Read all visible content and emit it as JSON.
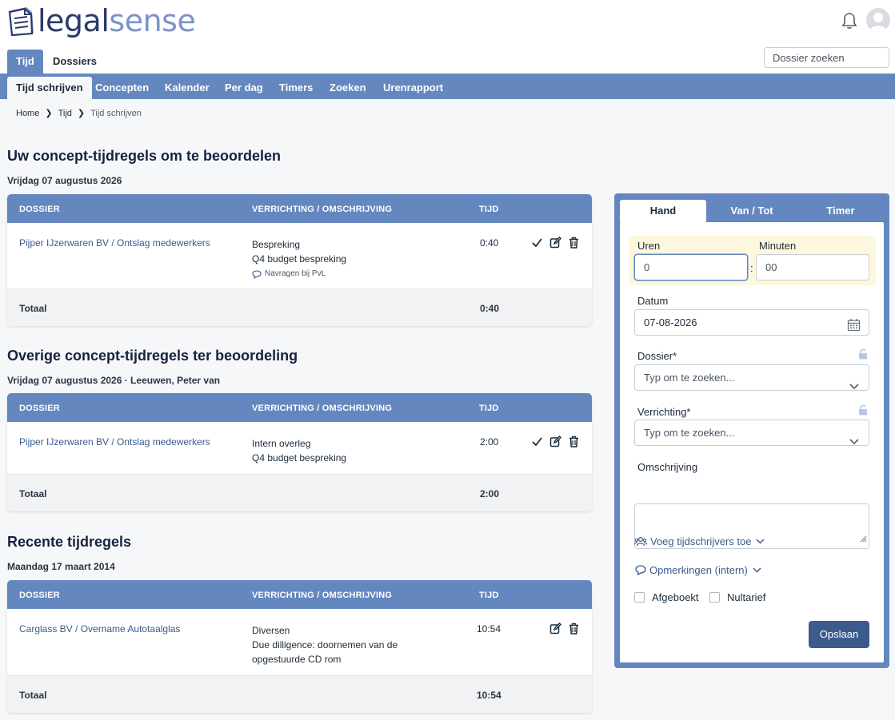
{
  "app": {
    "logo_part1": "legal",
    "logo_part2": "sense"
  },
  "primary_tabs": [
    {
      "label": "Tijd",
      "active": true
    },
    {
      "label": "Dossiers",
      "active": false
    }
  ],
  "search": {
    "placeholder": "Dossier zoeken"
  },
  "sub_tabs": [
    {
      "label": "Tijd schrijven",
      "active": true
    },
    {
      "label": "Concepten"
    },
    {
      "label": "Kalender"
    },
    {
      "label": "Per dag"
    },
    {
      "label": "Timers"
    },
    {
      "label": "Zoeken"
    },
    {
      "label": "Urenrapport"
    }
  ],
  "breadcrumb": [
    "Home",
    "Tijd",
    "Tijd schrijven"
  ],
  "columns": {
    "dossier": "DOSSIER",
    "verrichting": "VERRICHTING / OMSCHRIJVING",
    "tijd": "TIJD"
  },
  "total_label": "Totaal",
  "section1": {
    "title": "Uw concept-tijdregels om te beoordelen",
    "date": "Vrijdag 07 augustus 2026",
    "row": {
      "dossier": "Pijper IJzerwaren BV / Ontslag medewerkers",
      "verrichting": "Bespreking",
      "omschrijving": "Q4 budget bespreking",
      "note": "Navragen bij PvL",
      "tijd": "0:40"
    },
    "total": "0:40"
  },
  "section2": {
    "title": "Overige concept-tijdregels ter beoordeling",
    "date": "Vrijdag 07 augustus 2026 · Leeuwen, Peter van",
    "row": {
      "dossier": "Pijper IJzerwaren BV / Ontslag medewerkers",
      "verrichting": "Intern overleg",
      "omschrijving": "Q4 budget bespreking",
      "tijd": "2:00"
    },
    "total": "2:00"
  },
  "section3": {
    "title": "Recente tijdregels",
    "date": "Maandag 17 maart 2014",
    "row": {
      "dossier": "Carglass BV / Overname Autotaalglas",
      "verrichting": "Diversen",
      "omschrijving1": "Due dilligence: doornemen van de",
      "omschrijving2": "opgestuurde CD rom",
      "tijd": "10:54"
    },
    "total": "10:54"
  },
  "form": {
    "tabs": [
      "Hand",
      "Van / Tot",
      "Timer"
    ],
    "uren_label": "Uren",
    "uren_value": "0",
    "minuten_label": "Minuten",
    "minuten_value": "00",
    "colon": ":",
    "datum_label": "Datum",
    "datum_value": "07-08-2026",
    "dossier_label": "Dossier*",
    "dossier_placeholder": "Typ om te zoeken...",
    "verrichting_label": "Verrichting*",
    "verrichting_placeholder": "Typ om te zoeken...",
    "omschrijving_label": "Omschrijving",
    "add_writers": "Voeg tijdschrijvers toe",
    "remarks": "Opmerkingen (intern)",
    "afgeboekt": "Afgeboekt",
    "nultarief": "Nultarief",
    "save": "Opslaan"
  },
  "colors": {
    "primary": "#6487bf",
    "dark": "#3b5b8c",
    "highlight": "#fdf8dd"
  }
}
